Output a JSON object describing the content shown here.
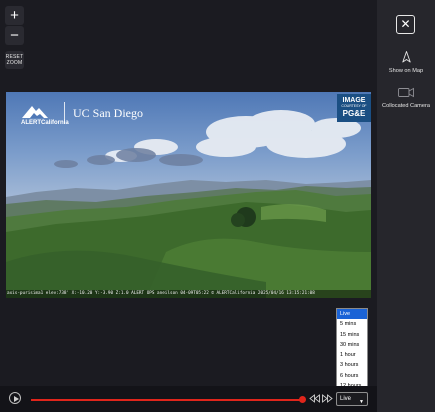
{
  "zoom": {
    "in_label": "+",
    "out_label": "−",
    "reset_label": "RESET\nZOOM"
  },
  "camera": {
    "logo_alert": "ALERTCalifornia",
    "logo_ucsd": "UC San Diego",
    "badge_line1": "IMAGE",
    "badge_line2": "COURTESY OF",
    "badge_line3": "PG&E",
    "caption": "axis-purisima1 elev:738' X:-10.20 Y:-3.90 Z:1.0 ALERT OPS aneilson 04-09T05:22 © ALERTCalifornia 2025/04/16 13:15:21:08"
  },
  "time_options": [
    "Live",
    "5 mins",
    "15 mins",
    "30 mins",
    "1 hour",
    "3 hours",
    "6 hours",
    "12 hours"
  ],
  "selected_time": "Live",
  "sidebar": {
    "close_label": "✕",
    "show_on_map": "Show on Map",
    "collocated_camera": "Collocated Camera"
  },
  "colors": {
    "accent_red": "#e0251b",
    "select_blue": "#1a63d6",
    "badge_blue": "#1b4f83"
  },
  "icons": [
    "plus-icon",
    "minus-icon",
    "close-icon",
    "map-pointer-icon",
    "camera-icon",
    "play-icon",
    "rewind-icon",
    "fast-forward-icon",
    "chevron-down-icon"
  ]
}
